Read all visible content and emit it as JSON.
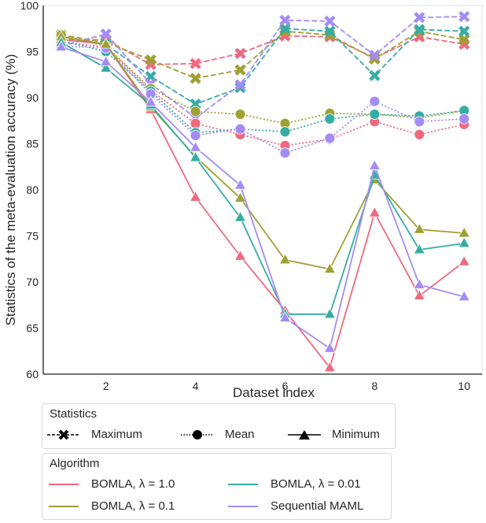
{
  "chart_data": {
    "type": "line",
    "title": "",
    "xlabel": "Dataset index",
    "ylabel": "Statistics of the meta-evaluation accuracy (%)",
    "xlim": [
      0.6,
      10.4
    ],
    "ylim": [
      60,
      100
    ],
    "xticks": [
      2,
      4,
      6,
      8,
      10
    ],
    "yticks": [
      60,
      65,
      70,
      75,
      80,
      85,
      90,
      95,
      100
    ],
    "grid": false,
    "x": [
      1,
      2,
      3,
      4,
      5,
      6,
      7,
      8,
      9,
      10
    ],
    "algorithms": [
      {
        "name": "BOMLA, λ = 1.0",
        "color": "#f0697f"
      },
      {
        "name": "BOMLA, λ = 0.1",
        "color": "#9da132"
      },
      {
        "name": "BOMLA, λ = 0.01",
        "color": "#36ada4"
      },
      {
        "name": "Sequential MAML",
        "color": "#a48cf4"
      }
    ],
    "statistics": [
      {
        "name": "Maximum",
        "marker": "x",
        "line": "dashed"
      },
      {
        "name": "Mean",
        "marker": "circle",
        "line": "dotted"
      },
      {
        "name": "Minimum",
        "marker": "triangle",
        "line": "solid"
      }
    ],
    "series": [
      {
        "algorithm": 0,
        "statistic": "Maximum",
        "values": [
          96.2,
          96.3,
          93.6,
          93.7,
          94.8,
          96.7,
          96.6,
          94.3,
          96.6,
          95.8
        ]
      },
      {
        "algorithm": 1,
        "statistic": "Maximum",
        "values": [
          96.8,
          96.0,
          94.1,
          92.1,
          93.0,
          97.2,
          96.8,
          94.2,
          97.2,
          96.3
        ]
      },
      {
        "algorithm": 2,
        "statistic": "Maximum",
        "values": [
          96.4,
          95.8,
          92.3,
          89.3,
          91.1,
          97.5,
          97.2,
          92.4,
          97.4,
          97.2
        ]
      },
      {
        "algorithm": 3,
        "statistic": "Maximum",
        "values": [
          95.6,
          96.9,
          91.5,
          87.8,
          91.4,
          98.4,
          98.3,
          94.6,
          98.7,
          98.8
        ]
      },
      {
        "algorithm": 0,
        "statistic": "Mean",
        "values": [
          96.0,
          95.5,
          90.8,
          87.2,
          86.0,
          84.8,
          85.5,
          87.4,
          86.0,
          87.1
        ]
      },
      {
        "algorithm": 1,
        "statistic": "Mean",
        "values": [
          96.8,
          95.6,
          91.0,
          88.5,
          88.2,
          87.2,
          88.3,
          88.2,
          87.8,
          88.6
        ]
      },
      {
        "algorithm": 2,
        "statistic": "Mean",
        "values": [
          96.2,
          95.0,
          90.7,
          86.2,
          86.6,
          86.3,
          87.7,
          88.2,
          88.0,
          88.6
        ]
      },
      {
        "algorithm": 3,
        "statistic": "Mean",
        "values": [
          95.6,
          95.4,
          90.4,
          85.9,
          86.6,
          84.0,
          85.6,
          89.6,
          87.4,
          87.7
        ]
      },
      {
        "algorithm": 0,
        "statistic": "Minimum",
        "values": [
          96.3,
          95.8,
          88.7,
          79.2,
          72.8,
          66.9,
          60.7,
          77.5,
          68.5,
          72.2
        ]
      },
      {
        "algorithm": 1,
        "statistic": "Minimum",
        "values": [
          96.6,
          95.8,
          89.0,
          83.6,
          79.1,
          72.4,
          71.4,
          81.1,
          75.7,
          75.3
        ]
      },
      {
        "algorithm": 2,
        "statistic": "Minimum",
        "values": [
          96.0,
          93.2,
          89.2,
          83.5,
          77.0,
          66.5,
          66.5,
          81.6,
          73.5,
          74.2
        ]
      },
      {
        "algorithm": 3,
        "statistic": "Minimum",
        "values": [
          95.5,
          93.9,
          89.5,
          84.6,
          80.5,
          66.1,
          62.8,
          82.6,
          69.7,
          68.4
        ]
      }
    ],
    "legend": {
      "statistics_title": "Statistics",
      "algorithm_title": "Algorithm",
      "placement": "bottom"
    }
  }
}
